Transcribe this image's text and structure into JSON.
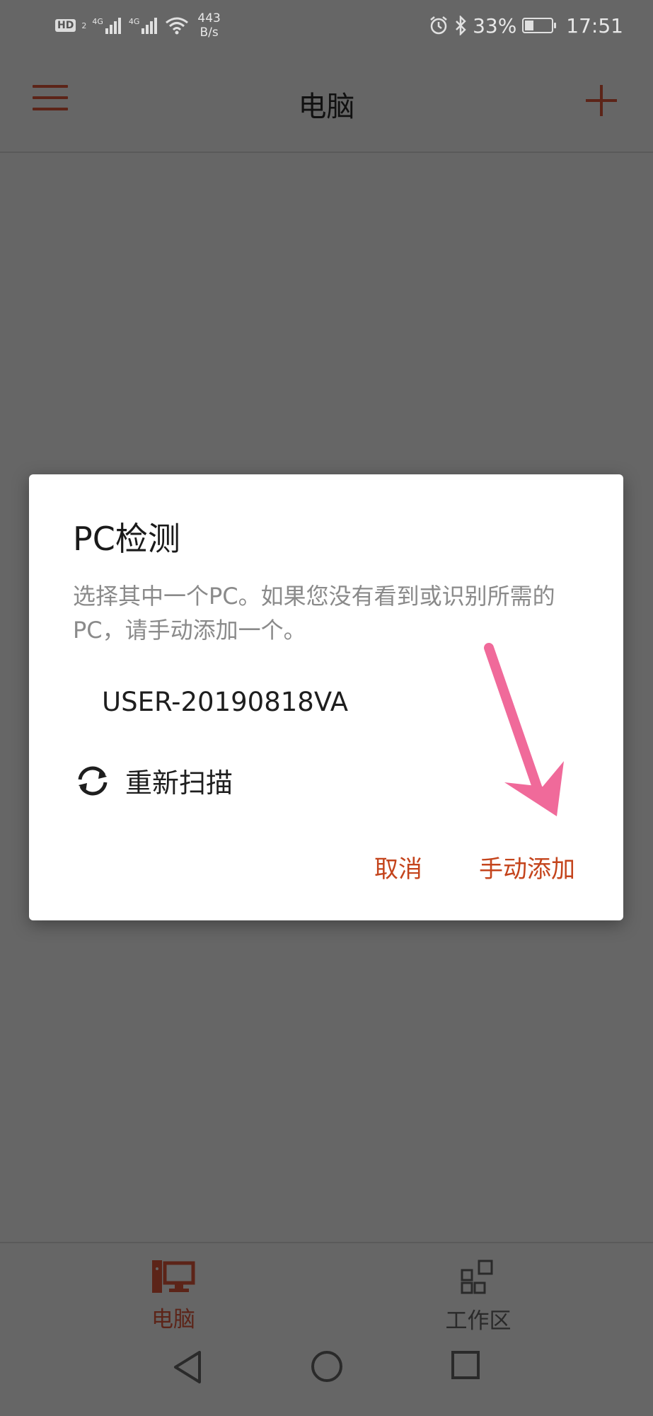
{
  "status_bar": {
    "hd_label": "HD",
    "hd_sub": "2",
    "sim1_label": "4G",
    "sim2_label": "4G",
    "net_speed_value": "443",
    "net_speed_unit": "B/s",
    "battery_percent": "33%",
    "battery_level": 0.33,
    "time": "17:51",
    "icons": [
      "hd-icon",
      "signal-icon",
      "wifi-icon",
      "alarm-icon",
      "bluetooth-icon",
      "battery-icon"
    ]
  },
  "app_bar": {
    "title": "电脑",
    "accent_color": "#5c2418"
  },
  "dialog": {
    "title": "PC检测",
    "message": "选择其中一个PC。如果您没有看到或识别所需的PC，请手动添加一个。",
    "pc_items": [
      "USER-20190818VA"
    ],
    "rescan_label": "重新扫描",
    "cancel_label": "取消",
    "manual_add_label": "手动添加",
    "button_color": "#c4441c",
    "annotation_arrow_color": "#f06a9a"
  },
  "bottom_nav": {
    "items": [
      {
        "label": "电脑",
        "active": true,
        "color": "#5c2418"
      },
      {
        "label": "工作区",
        "active": false,
        "color": "#2a2a2a"
      }
    ]
  },
  "system_nav": {
    "icons": [
      "back-triangle-icon",
      "home-circle-icon",
      "recents-square-icon"
    ]
  }
}
